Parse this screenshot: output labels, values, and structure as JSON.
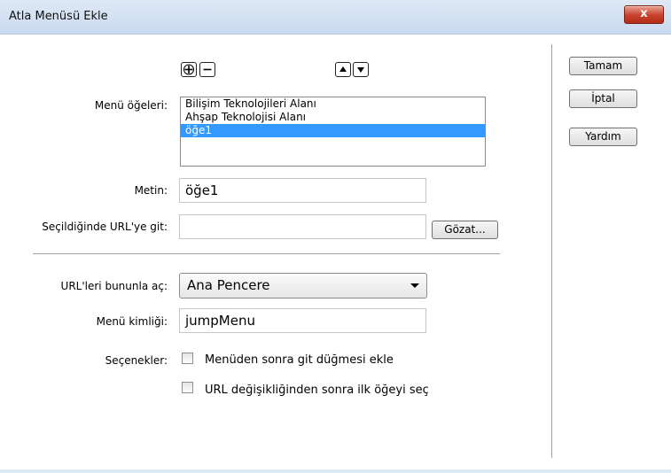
{
  "window": {
    "title": "Atla Menüsü Ekle",
    "close_label": "x"
  },
  "toolbar": {
    "add_icon": "plus-icon",
    "remove_icon": "minus-icon",
    "up_icon": "up-arrow-icon",
    "down_icon": "down-arrow-icon"
  },
  "menu_items": {
    "label": "Menü öğeleri:",
    "items": [
      "Bilişim Teknolojileri Alanı",
      "Ahşap Teknolojisi Alanı",
      "öğe1"
    ],
    "selected_index": 2
  },
  "text_field": {
    "label": "Metin:",
    "value": "öğe1"
  },
  "url_field": {
    "label": "Seçildiğinde URL'ye git:",
    "value": "",
    "browse_label": "Gözat..."
  },
  "open_urls": {
    "label": "URL'leri bununla aç:",
    "selected": "Ana Pencere"
  },
  "menu_id": {
    "label": "Menü kimliği:",
    "value": "jumpMenu"
  },
  "options": {
    "label": "Seçenekler:",
    "go_button": {
      "label": "Menüden sonra git düğmesi ekle",
      "checked": false
    },
    "select_first": {
      "label": "URL değişikliğinden sonra ilk öğeyi seç",
      "checked": false
    }
  },
  "buttons": {
    "ok": "Tamam",
    "cancel": "İptal",
    "help": "Yardım"
  },
  "colors": {
    "selection": "#3399ff",
    "titlebar": "#dfe9f5",
    "close": "#c7402c"
  }
}
